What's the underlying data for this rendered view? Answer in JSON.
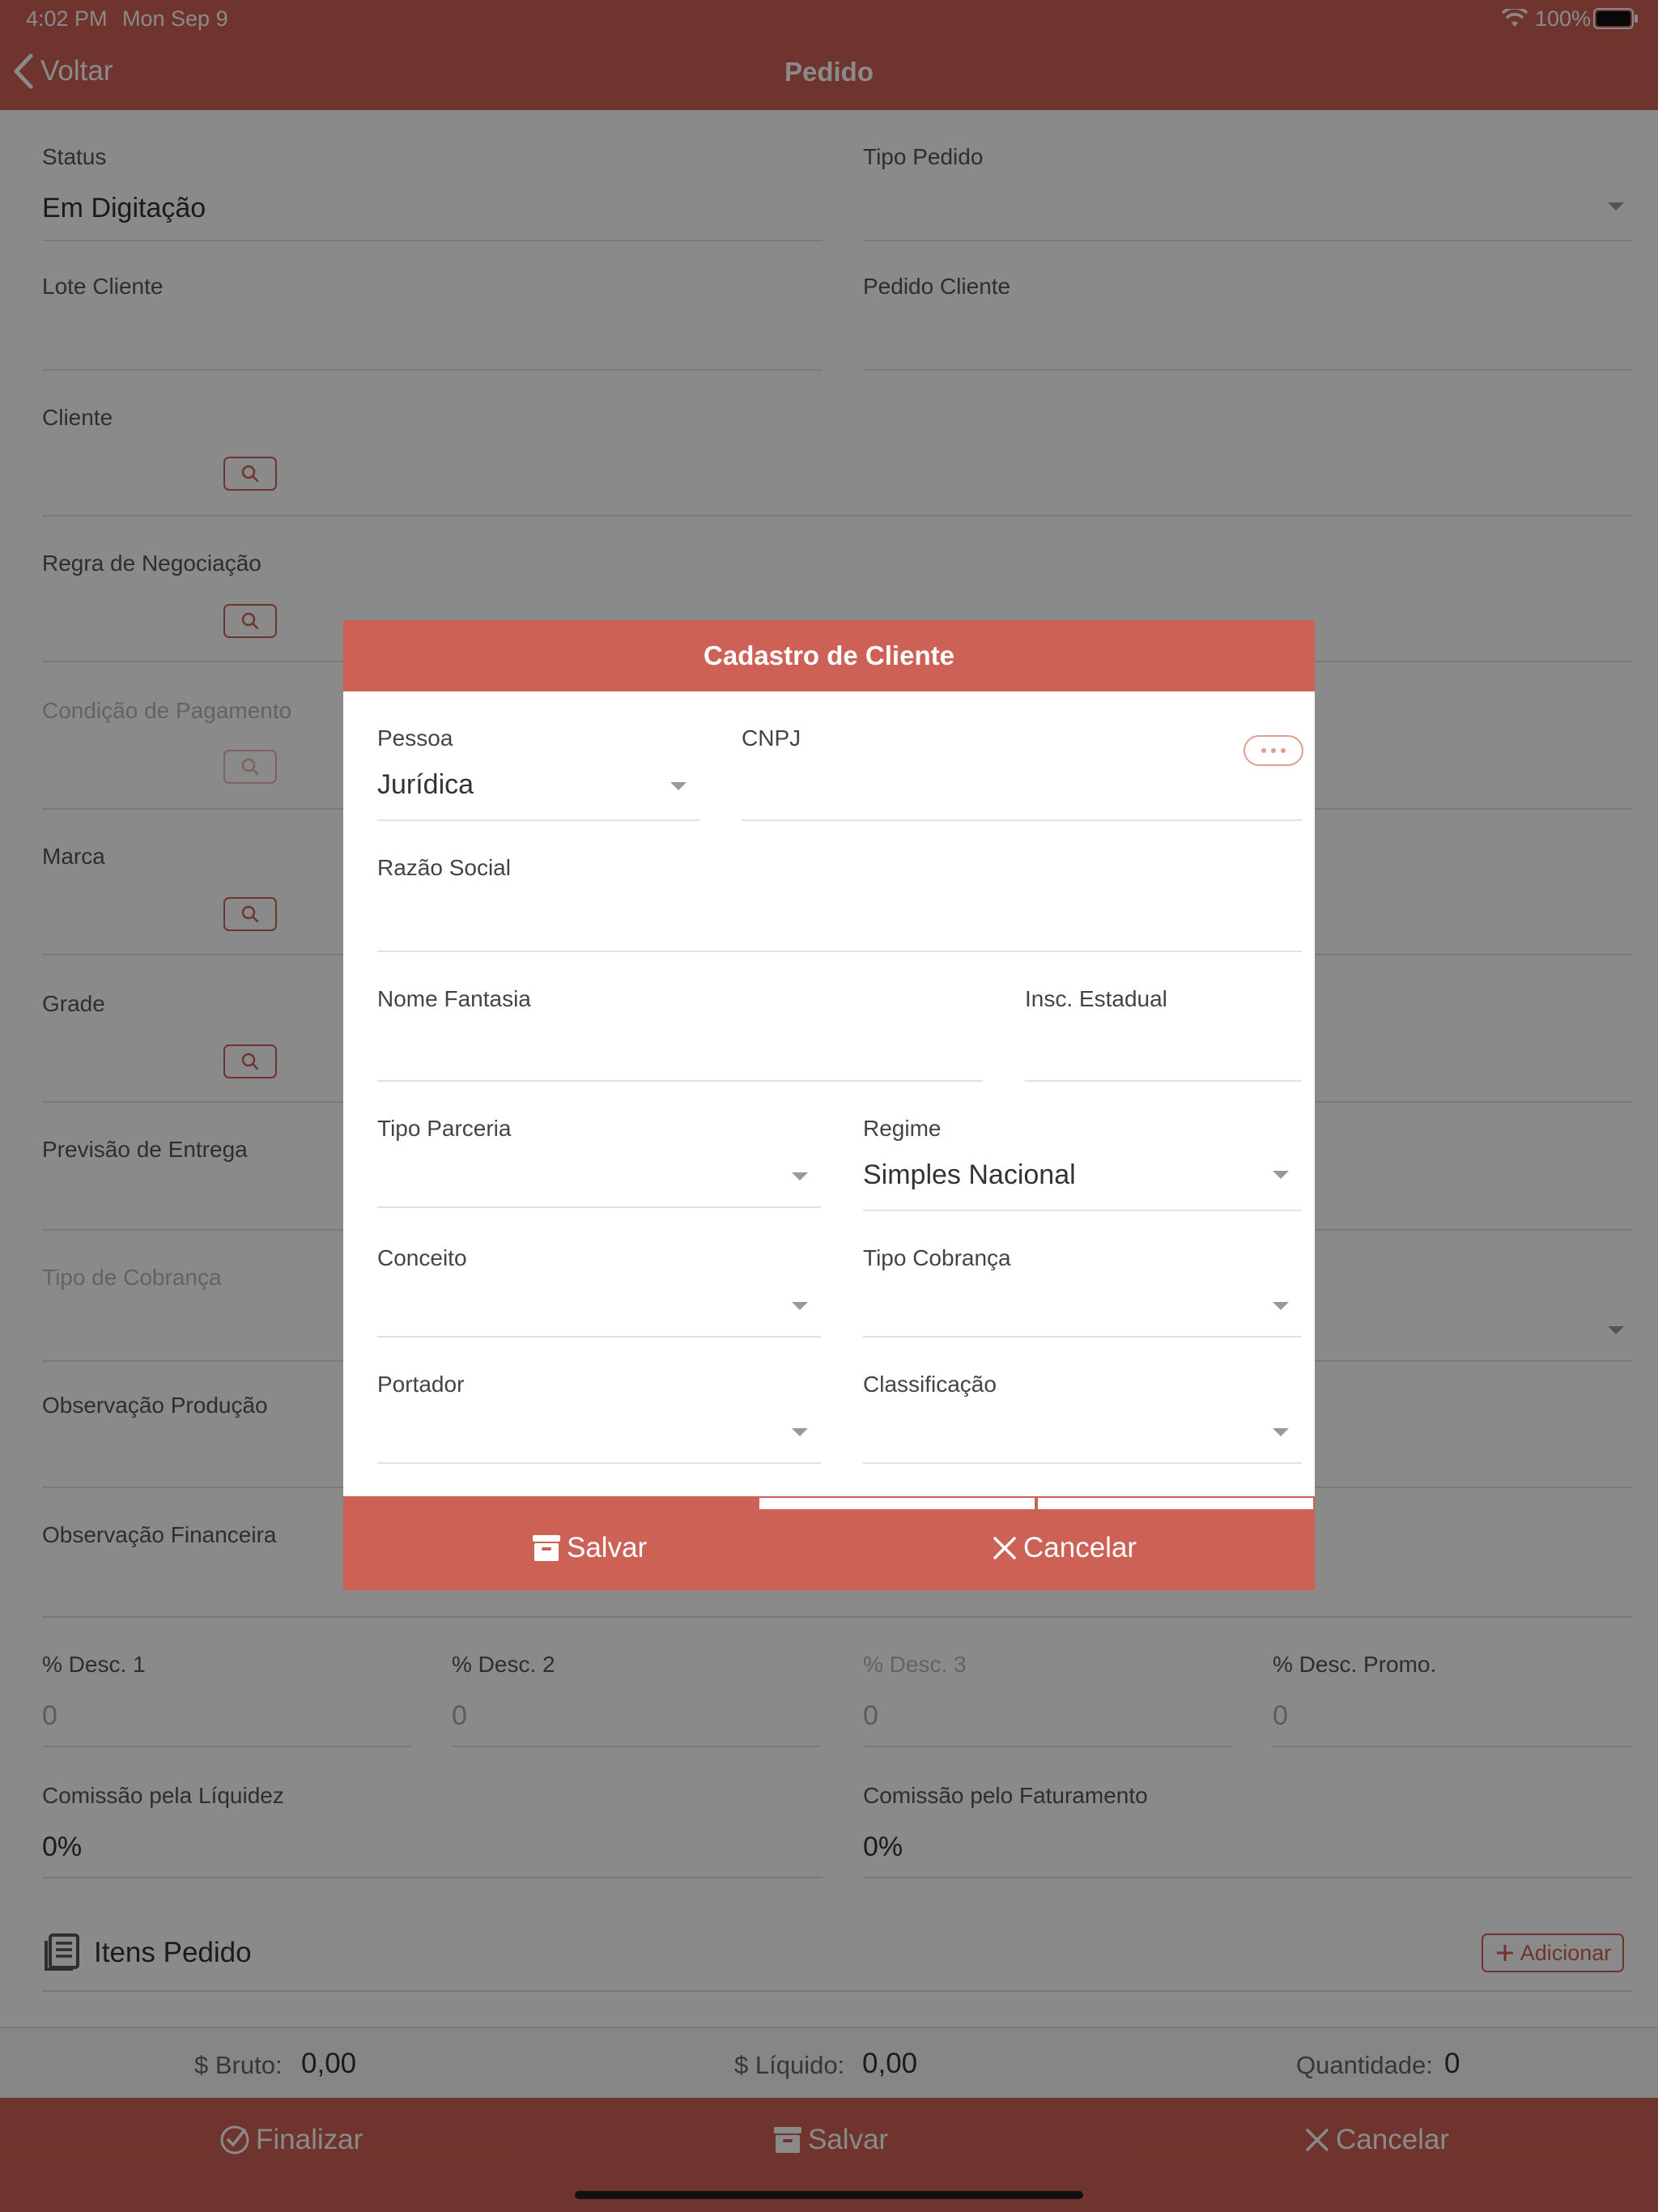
{
  "status_bar": {
    "time": "4:02 PM",
    "date": "Mon Sep 9",
    "battery": "100%"
  },
  "nav": {
    "back_label": "Voltar",
    "title": "Pedido"
  },
  "form": {
    "status_label": "Status",
    "status_value": "Em Digitação",
    "tipo_pedido_label": "Tipo Pedido",
    "lote_cliente_label": "Lote Cliente",
    "pedido_cliente_label": "Pedido Cliente",
    "cliente_label": "Cliente",
    "regra_label": "Regra de Negociação",
    "condicao_label": "Condição de Pagamento",
    "marca_label": "Marca",
    "grade_label": "Grade",
    "previsao_label": "Previsão de Entrega",
    "tipo_cobranca_label": "Tipo de Cobrança",
    "obs_producao_label": "Observação Produção",
    "obs_financeira_label": "Observação Financeira",
    "desc1_label": "% Desc. 1",
    "desc1_value": "0",
    "desc2_label": "% Desc. 2",
    "desc2_value": "0",
    "desc3_label": "% Desc. 3",
    "desc3_value": "0",
    "desc_promo_label": "% Desc. Promo.",
    "desc_promo_value": "0",
    "com_liquidez_label": "Comissão pela Líquidez",
    "com_liquidez_value": "0%",
    "com_faturamento_label": "Comissão pelo Faturamento",
    "com_faturamento_value": "0%",
    "itens_label": "Itens Pedido",
    "adicionar_label": "Adicionar"
  },
  "totals": {
    "bruto_label": "$ Bruto:",
    "bruto_value": "0,00",
    "liquido_label": "$ Líquido:",
    "liquido_value": "0,00",
    "quantidade_label": "Quantidade:",
    "quantidade_value": "0"
  },
  "toolbar": {
    "finalizar": "Finalizar",
    "salvar": "Salvar",
    "cancelar": "Cancelar"
  },
  "modal": {
    "title": "Cadastro de Cliente",
    "pessoa_label": "Pessoa",
    "pessoa_value": "Jurídica",
    "cnpj_label": "CNPJ",
    "razao_label": "Razão Social",
    "nome_fantasia_label": "Nome Fantasia",
    "insc_label": "Insc. Estadual",
    "tipo_parceria_label": "Tipo Parceria",
    "regime_label": "Regime",
    "regime_value": "Simples Nacional",
    "conceito_label": "Conceito",
    "tipo_cobranca_label": "Tipo Cobrança",
    "portador_label": "Portador",
    "classificacao_label": "Classificação",
    "salvar": "Salvar",
    "cancelar": "Cancelar"
  },
  "colors": {
    "accent": "#cd6156",
    "overlay": "rgba(0,0,0,0.46)"
  }
}
